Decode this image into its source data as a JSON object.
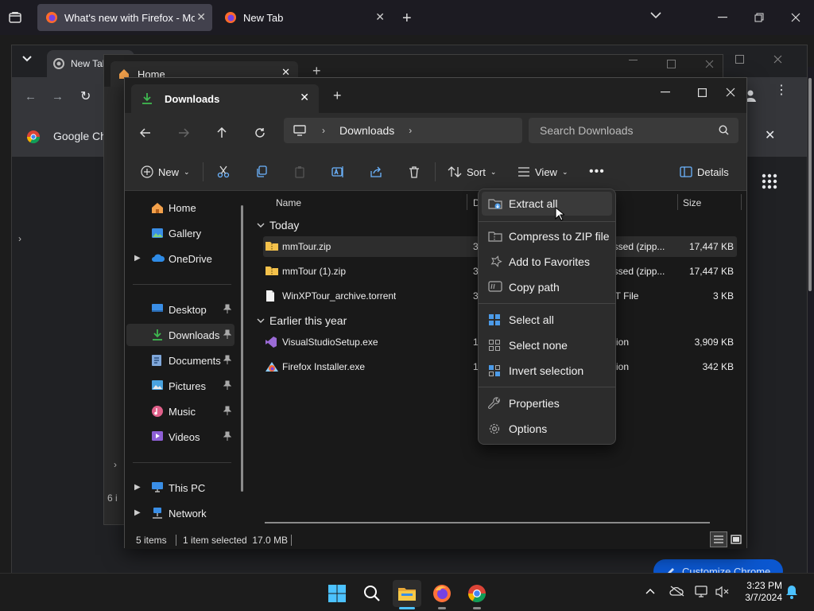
{
  "firefox": {
    "tabs": [
      {
        "title": "What's new with Firefox - More",
        "active": true
      },
      {
        "title": "New Tab",
        "active": false
      }
    ]
  },
  "chrome": {
    "tab_title": "New Tab",
    "bookmark": "Google Ch",
    "customize_label": "Customize Chrome",
    "side_text": "6 i"
  },
  "middle_window": {
    "tab_title": "Home"
  },
  "explorer": {
    "tab_title": "Downloads",
    "address_segment": "Downloads",
    "search_placeholder": "Search Downloads",
    "commands": {
      "new": "New",
      "sort": "Sort",
      "view": "View",
      "details": "Details"
    },
    "nav": {
      "home": "Home",
      "gallery": "Gallery",
      "onedrive": "OneDrive",
      "desktop": "Desktop",
      "downloads": "Downloads",
      "documents": "Documents",
      "pictures": "Pictures",
      "music": "Music",
      "videos": "Videos",
      "thispc": "This PC",
      "network": "Network"
    },
    "columns": {
      "name": "Name",
      "date": "D",
      "size": "Size"
    },
    "groups": {
      "today": "Today",
      "earlier": "Earlier this year"
    },
    "files": [
      {
        "name": "mmTour.zip",
        "date": "3",
        "type": "essed (zipp...",
        "size": "17,447 KB",
        "selected": true,
        "icon": "zip-folder-icon"
      },
      {
        "name": "mmTour (1).zip",
        "date": "3",
        "type": "essed (zipp...",
        "size": "17,447 KB",
        "selected": false,
        "icon": "zip-folder-icon"
      },
      {
        "name": "WinXPTour_archive.torrent",
        "date": "3",
        "type": "NT File",
        "size": "3 KB",
        "selected": false,
        "icon": "file-icon"
      },
      {
        "name": "VisualStudioSetup.exe",
        "date": "1",
        "type": "ation",
        "size": "3,909 KB",
        "selected": false,
        "icon": "visual-studio-icon"
      },
      {
        "name": "Firefox Installer.exe",
        "date": "1",
        "type": "ation",
        "size": "342 KB",
        "selected": false,
        "icon": "firefox-installer-icon"
      }
    ],
    "status": {
      "count": "5 items",
      "selection": "1 item selected  17.0 MB"
    }
  },
  "context_menu": {
    "items": [
      {
        "label": "Extract all",
        "icon": "extract-icon"
      },
      {
        "label": "Compress to ZIP file",
        "icon": "zip-icon"
      },
      {
        "label": "Add to Favorites",
        "icon": "star-icon"
      },
      {
        "label": "Copy path",
        "icon": "copy-path-icon"
      },
      {
        "label": "Select all",
        "icon": "select-all-icon"
      },
      {
        "label": "Select none",
        "icon": "select-none-icon"
      },
      {
        "label": "Invert selection",
        "icon": "invert-selection-icon"
      },
      {
        "label": "Properties",
        "icon": "wrench-icon"
      },
      {
        "label": "Options",
        "icon": "gear-icon"
      }
    ]
  },
  "taskbar": {
    "time": "3:23 PM",
    "date": "3/7/2024"
  },
  "colors": {
    "accent": "#4cc2ff",
    "folder": "#f3c14b",
    "downloads_green": "#3fb950"
  }
}
